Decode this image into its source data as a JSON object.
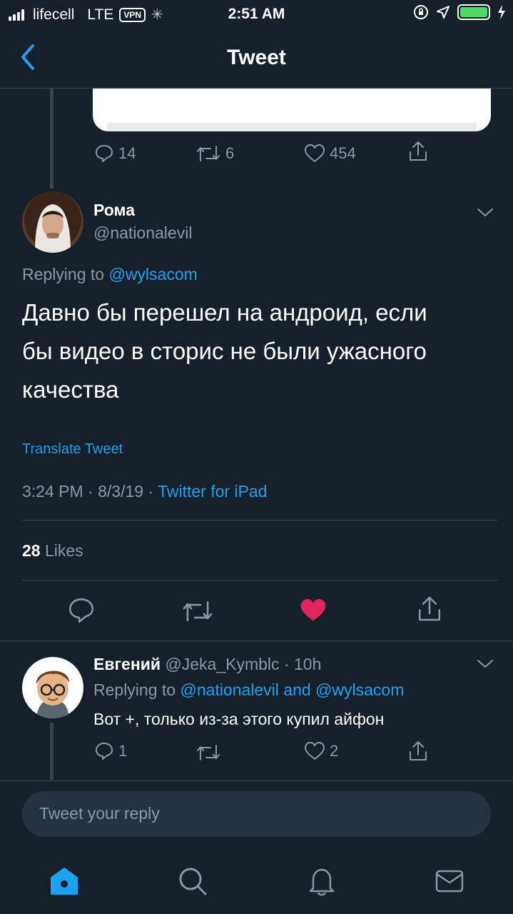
{
  "status_bar": {
    "carrier": "lifecell",
    "network": "LTE",
    "vpn": "VPN",
    "time": "2:51 AM"
  },
  "nav": {
    "title": "Tweet"
  },
  "previous_tweet": {
    "reply_count": "14",
    "retweet_count": "6",
    "like_count": "454"
  },
  "main_tweet": {
    "author_name": "Рома",
    "author_handle": "@nationalevil",
    "replying_label": "Replying to",
    "replying_handle": "@wylsacom",
    "text_line1": "Давно бы перешел на андроид, если",
    "text_line2": "бы видео в сторис не были ужасного",
    "text_line3": "качества",
    "translate_label": "Translate Tweet",
    "timestamp": "3:24 PM · 8/3/19 · ",
    "source": "Twitter for iPad",
    "likes_count": "28",
    "likes_label": "Likes"
  },
  "reply_tweet": {
    "author_name": "Евгений",
    "author_handle": "@Jeka_Kymblc",
    "time": "· 10h",
    "replying_label": "Replying to",
    "replying_handles": "@nationalevil and @wylsacom",
    "text": "Вот +, только из-за этого купил айфон",
    "reply_count": "1",
    "like_count": "2"
  },
  "composer": {
    "placeholder": "Tweet your reply"
  },
  "colors": {
    "background": "#15202b",
    "accent": "#1da1f2",
    "like_active": "#e0245e",
    "muted": "#8899a6"
  }
}
